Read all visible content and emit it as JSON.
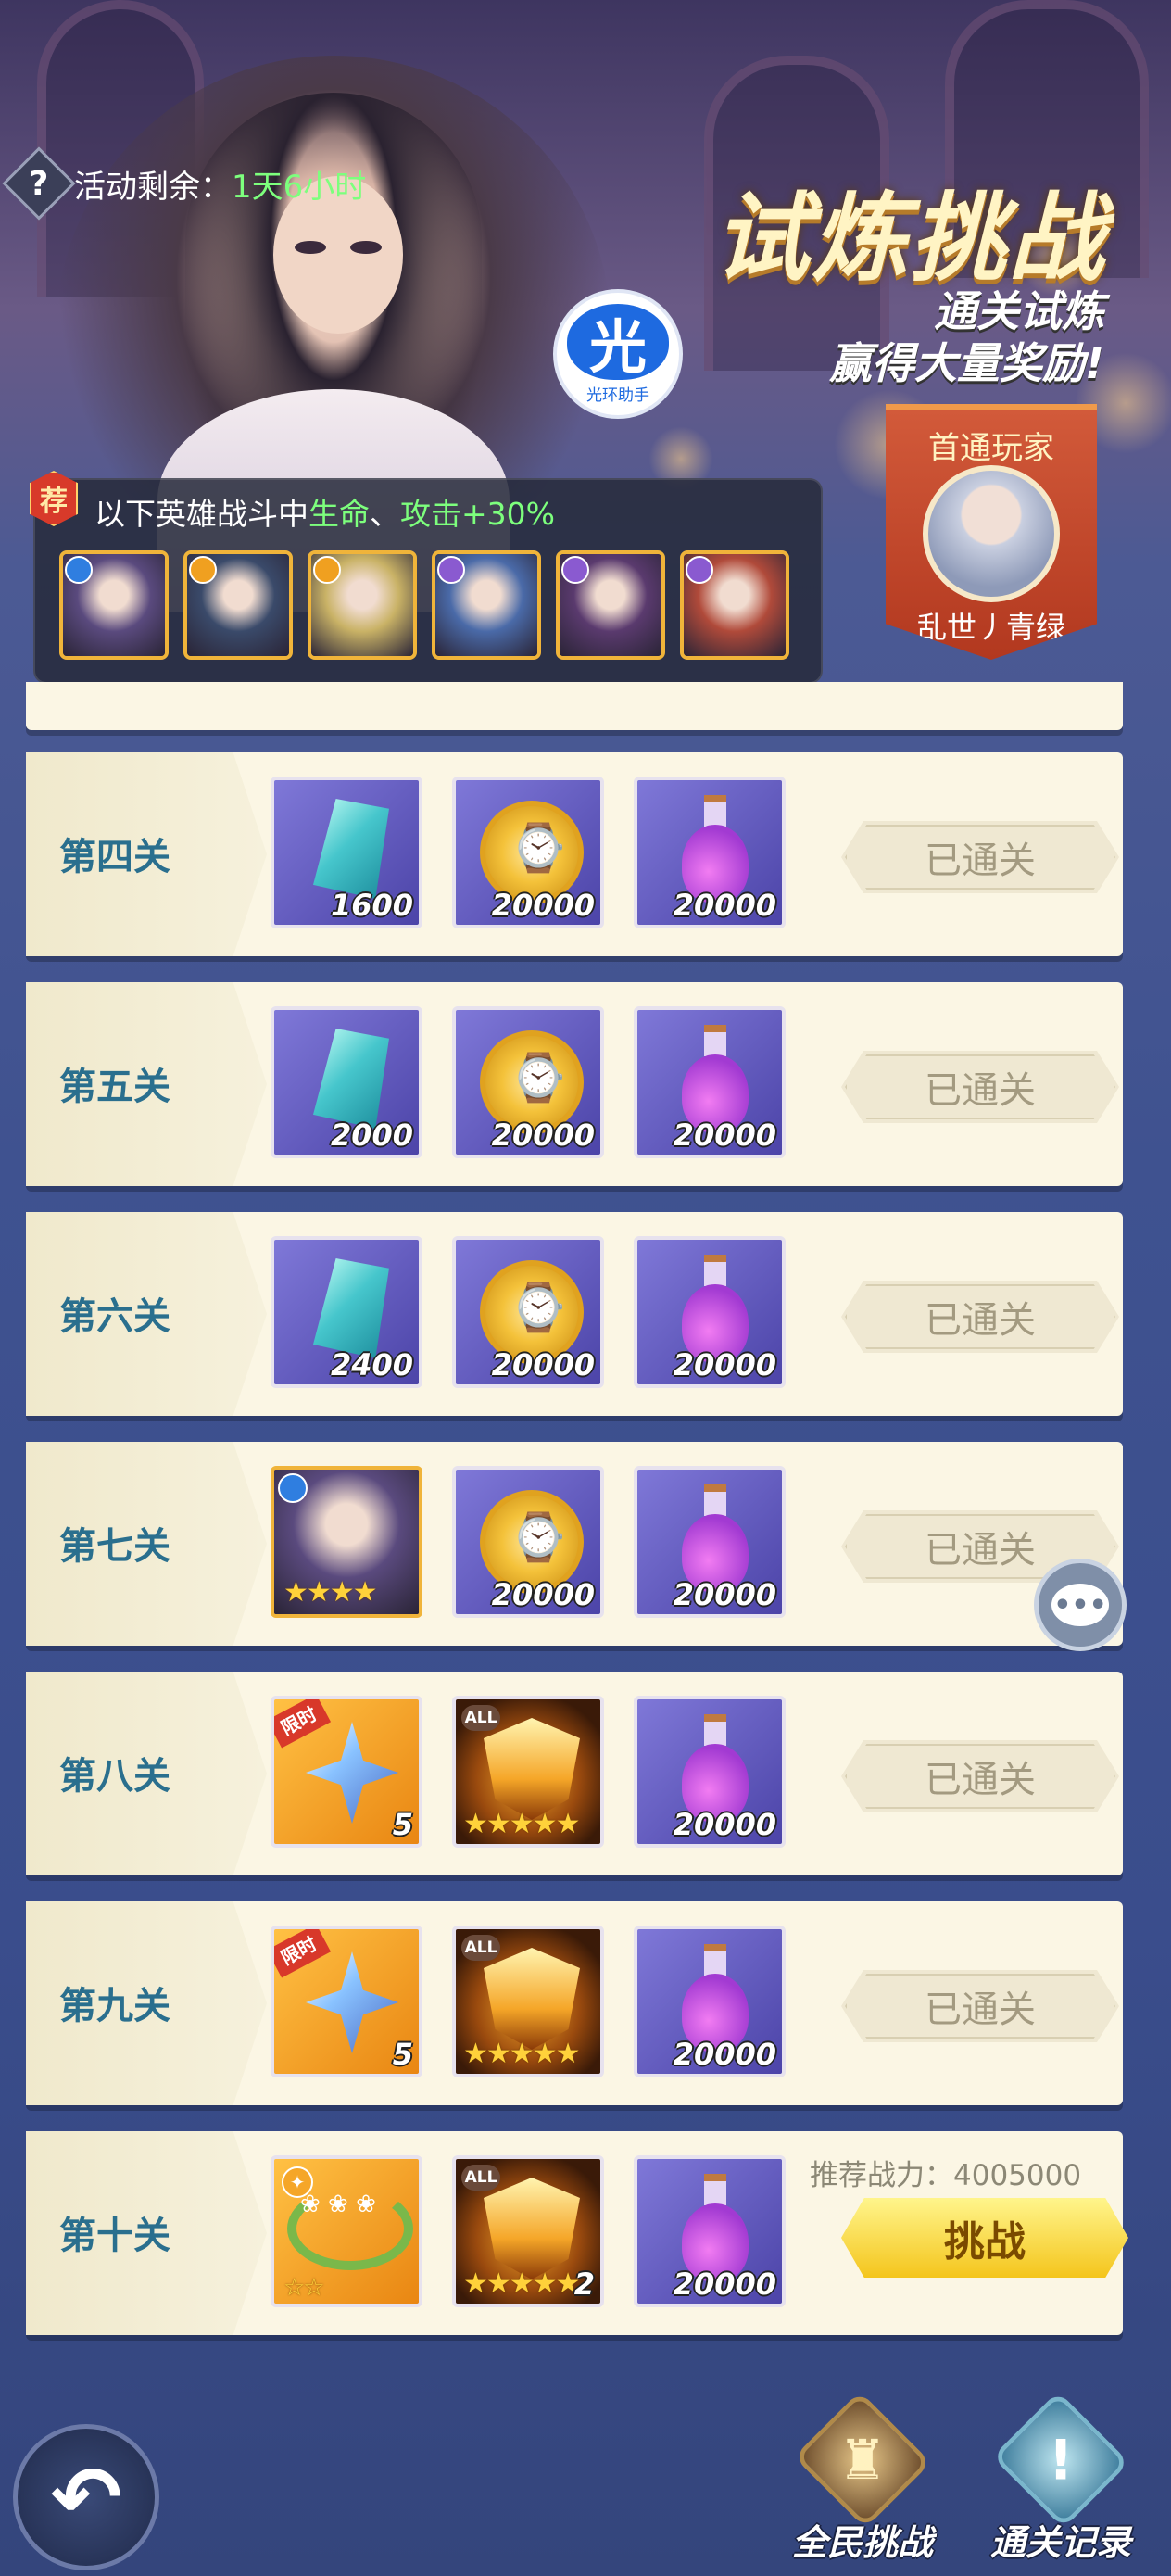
{
  "header": {
    "help_icon": "?",
    "timer_label": "活动剩余：",
    "timer_value": "1天6小时",
    "title": "试炼挑战",
    "subtitle_1": "通关试炼",
    "subtitle_2": "赢得大量奖励!",
    "helper_glyph": "光",
    "helper_label": "光环助手"
  },
  "first_clear": {
    "title": "首通玩家",
    "player_name": "乱世丿青绿"
  },
  "buff": {
    "badge": "荐",
    "text_prefix": "以下英雄战斗中",
    "stat_1": "生命",
    "sep": "、",
    "stat_2": "攻击+30%",
    "heroes": [
      {
        "element": "water",
        "element_color": "#2f7ee0",
        "bg": "#5a4a7e"
      },
      {
        "element": "light",
        "element_color": "#f0a020",
        "bg": "#3a4a6a"
      },
      {
        "element": "light",
        "element_color": "#f0a020",
        "bg": "#c9b266"
      },
      {
        "element": "dark",
        "element_color": "#8a5ad0",
        "bg": "#4a6aa8"
      },
      {
        "element": "dark",
        "element_color": "#8a5ad0",
        "bg": "#5a3a6e"
      },
      {
        "element": "dark",
        "element_color": "#8a5ad0",
        "bg": "#b04a3a"
      }
    ]
  },
  "stages": [
    {
      "name": "第四关",
      "rewards": [
        {
          "type": "crystal",
          "qty": "1600"
        },
        {
          "type": "coin",
          "qty": "20000"
        },
        {
          "type": "potion",
          "qty": "20000"
        }
      ],
      "status": "已通关"
    },
    {
      "name": "第五关",
      "rewards": [
        {
          "type": "crystal",
          "qty": "2000"
        },
        {
          "type": "coin",
          "qty": "20000"
        },
        {
          "type": "potion",
          "qty": "20000"
        }
      ],
      "status": "已通关"
    },
    {
      "name": "第六关",
      "rewards": [
        {
          "type": "crystal",
          "qty": "2400"
        },
        {
          "type": "coin",
          "qty": "20000"
        },
        {
          "type": "potion",
          "qty": "20000"
        }
      ],
      "status": "已通关"
    },
    {
      "name": "第七关",
      "rewards": [
        {
          "type": "hero",
          "stars": "★★★★"
        },
        {
          "type": "coin",
          "qty": "20000"
        },
        {
          "type": "potion",
          "qty": "20000"
        }
      ],
      "status": "已通关"
    },
    {
      "name": "第八关",
      "rewards": [
        {
          "type": "shuriken",
          "tag": "限时",
          "qty": "5"
        },
        {
          "type": "mask",
          "tag": "ALL",
          "stars": "★★★★★"
        },
        {
          "type": "potion",
          "qty": "20000"
        }
      ],
      "status": "已通关"
    },
    {
      "name": "第九关",
      "rewards": [
        {
          "type": "shuriken",
          "tag": "限时",
          "qty": "5"
        },
        {
          "type": "mask",
          "tag": "ALL",
          "stars": "★★★★★"
        },
        {
          "type": "potion",
          "qty": "20000"
        }
      ],
      "status": "已通关"
    },
    {
      "name": "第十关",
      "rewards": [
        {
          "type": "wreath",
          "stars": "☆☆"
        },
        {
          "type": "mask",
          "tag": "ALL",
          "stars": "★★★★★",
          "qty": "2"
        },
        {
          "type": "potion",
          "qty": "20000"
        }
      ],
      "recommend_label": "推荐战力：",
      "recommend_value": "4005000",
      "action": "挑战"
    }
  ],
  "chat_icon": "•••",
  "footer": {
    "back_glyph": "↶",
    "all_challenge_label": "全民挑战",
    "clear_record_label": "通关记录",
    "all_challenge_glyph": "♜",
    "clear_record_glyph": "!"
  },
  "colors": {
    "stage_name": "#2a6f8e",
    "highlight_green": "#7dff7d",
    "challenge_button": "#f4c51c"
  }
}
